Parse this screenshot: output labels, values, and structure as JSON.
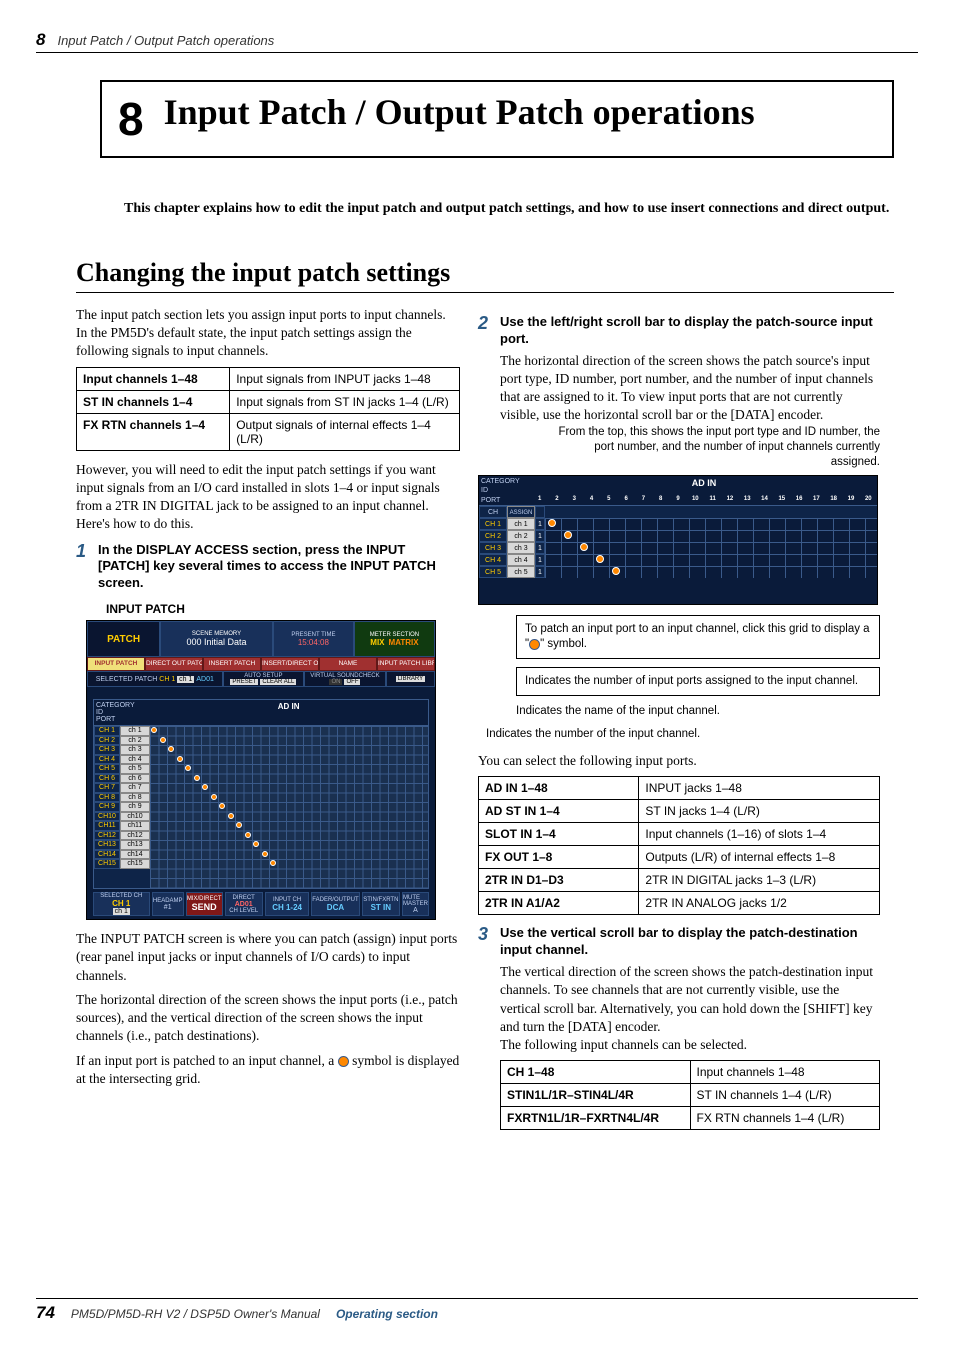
{
  "header": {
    "page_num": "8",
    "section": "Input Patch / Output Patch operations"
  },
  "chapter": {
    "num": "8",
    "title": "Input Patch / Output Patch operations"
  },
  "intro": "This chapter explains how to edit the input patch and output patch settings, and how to use insert connections and direct output.",
  "h1": "Changing the input patch settings",
  "left": {
    "p1": "The input patch section lets you assign input ports to input channels. In the PM5D's default state, the input patch settings assign the following signals to input channels.",
    "table1": [
      [
        "Input channels 1–48",
        "Input signals from INPUT jacks 1–48"
      ],
      [
        "ST IN channels 1–4",
        "Input signals from ST IN jacks 1–4 (L/R)"
      ],
      [
        "FX RTN channels 1–4",
        "Output signals of internal effects 1–4 (L/R)"
      ]
    ],
    "p2": "However, you will need to edit the input patch settings if you want input signals from an I/O card installed in slots 1–4 or input signals from a 2TR IN DIGITAL jack to be assigned to an input channel. Here's how to do this.",
    "step1": {
      "num": "1",
      "title": "In the DISPLAY ACCESS section, press the INPUT [PATCH] key several times to access the INPUT PATCH screen."
    },
    "caption": "INPUT PATCH",
    "p3": "The INPUT PATCH screen is where you can patch (assign) input ports (rear panel input jacks or input channels of I/O cards) to input channels.",
    "p4": "The horizontal direction of the screen shows the input ports (i.e., patch sources), and the vertical direction of the screen shows the input channels (i.e., patch destinations).",
    "p5a": "If an input port is patched to an input channel, a ",
    "p5b": " symbol is displayed at the intersecting grid."
  },
  "screenshot": {
    "patch_label": "PATCH",
    "scene_memory_label": "SCENE MEMORY",
    "scene_text": "000 Initial Data",
    "present_time_label": "PRESENT TIME",
    "present_time": "15:04:08",
    "meter_section_label": "METER SECTION",
    "mix": "MIX",
    "matrix": "MATRIX",
    "tabs": [
      "INPUT PATCH",
      "DIRECT OUT PATCH",
      "INSERT PATCH",
      "INSERT/DIRECT OUT POINT",
      "NAME",
      "INPUT PATCH LIBRARY"
    ],
    "sel_patch": "SELECTED PATCH",
    "sel_ch": "CH 1",
    "sel_name": "ch 1",
    "sel_port": "AD01",
    "auto_setup": "AUTO SETUP",
    "preset": "PRESET",
    "clear_all": "CLEAR ALL",
    "virtual_sc": "VIRTUAL SOUNDCHECK",
    "on": "ON",
    "off": "OFF",
    "library": "LIBRARY",
    "category": "CATEGORY",
    "id": "ID",
    "port": "PORT",
    "ch_col": "CH",
    "assign": "ASSIGN",
    "ad_in": "AD IN",
    "rows": [
      {
        "ch": "CH 1",
        "name": "ch 1"
      },
      {
        "ch": "CH 2",
        "name": "ch 2"
      },
      {
        "ch": "CH 3",
        "name": "ch 3"
      },
      {
        "ch": "CH 4",
        "name": "ch 4"
      },
      {
        "ch": "CH 5",
        "name": "ch 5"
      },
      {
        "ch": "CH 6",
        "name": "ch 6"
      },
      {
        "ch": "CH 7",
        "name": "ch 7"
      },
      {
        "ch": "CH 8",
        "name": "ch 8"
      },
      {
        "ch": "CH 9",
        "name": "ch 9"
      },
      {
        "ch": "CH10",
        "name": "ch10"
      },
      {
        "ch": "CH11",
        "name": "ch11"
      },
      {
        "ch": "CH12",
        "name": "ch12"
      },
      {
        "ch": "CH13",
        "name": "ch13"
      },
      {
        "ch": "CH14",
        "name": "ch14"
      },
      {
        "ch": "CH15",
        "name": "ch15"
      }
    ],
    "bottom": {
      "selected_ch": "SELECTED CH",
      "ch1": "CH 1",
      "chname": "ch 1",
      "headamp": "HEADAMP",
      "num1": "#1",
      "mix_direct": "MIX/DIRECT",
      "send": "SEND",
      "direct": "DIRECT",
      "dir_val": "AD01",
      "ch_level": "CH LEVEL",
      "input_ch": "INPUT CH",
      "ch124": "CH 1-24",
      "fader_output": "FADER/OUTPUT",
      "dca": "DCA",
      "stin_fxrtn": "STIN/FXRTN",
      "stin": "ST IN",
      "mute_master": "MUTE MASTER",
      "a": "A"
    }
  },
  "right": {
    "step2": {
      "num": "2",
      "title": "Use the left/right scroll bar to display the patch-source input port."
    },
    "p2a": "The horizontal direction of the screen shows the patch source's input port type, ID number, port number, and the number of input channels that are assigned to it. To view input ports that are not currently visible, use the horizontal scroll bar or the [DATA] encoder.",
    "callout1": "From the top, this shows the input port type and ID number, the port number, and the number of input channels currently assigned.",
    "callout2a": "To patch an input port to an input channel, click this grid to display a \"",
    "callout2b": "\" symbol.",
    "callout3": "Indicates the number of input ports assigned to the input channel.",
    "callout4": "Indicates the name of the input channel.",
    "callout5": "Indicates the number of the input channel.",
    "mini": {
      "category": "CATEGORY",
      "id": "ID",
      "port": "PORT",
      "ch": "CH",
      "assign": "ASSIGN",
      "adin": "AD IN",
      "ports": [
        "1",
        "2",
        "3",
        "4",
        "5",
        "6",
        "7",
        "8",
        "9",
        "10",
        "11",
        "12",
        "13",
        "14",
        "15",
        "16",
        "17",
        "18",
        "19",
        "20"
      ],
      "rows": [
        {
          "ch": "CH 1",
          "name": "ch 1",
          "n": "1"
        },
        {
          "ch": "CH 2",
          "name": "ch 2",
          "n": "1"
        },
        {
          "ch": "CH 3",
          "name": "ch 3",
          "n": "1"
        },
        {
          "ch": "CH 4",
          "name": "ch 4",
          "n": "1"
        },
        {
          "ch": "CH 5",
          "name": "ch 5",
          "n": "1"
        }
      ]
    },
    "p_ports": "You can select the following input ports.",
    "table_ports": [
      [
        "AD IN 1–48",
        "INPUT jacks 1–48"
      ],
      [
        "AD ST IN 1–4",
        "ST IN jacks 1–4 (L/R)"
      ],
      [
        "SLOT IN 1–4",
        "Input channels (1–16) of slots 1–4"
      ],
      [
        "FX OUT 1–8",
        "Outputs (L/R) of internal effects 1–8"
      ],
      [
        "2TR IN D1–D3",
        "2TR IN DIGITAL jacks 1–3 (L/R)"
      ],
      [
        "2TR IN A1/A2",
        "2TR IN ANALOG jacks 1/2"
      ]
    ],
    "step3": {
      "num": "3",
      "title": "Use the vertical scroll bar to display the patch-destination input channel."
    },
    "p3a": "The vertical direction of the screen shows the patch-destination input channels. To see channels that are not currently visible, use the vertical scroll bar. Alternatively, you can hold down the [SHIFT] key and turn the [DATA] encoder.",
    "p3b": "The following input channels can be selected.",
    "table_ch": [
      [
        "CH 1–48",
        "Input channels 1–48"
      ],
      [
        "STIN1L/1R–STIN4L/4R",
        "ST IN channels 1–4 (L/R)"
      ],
      [
        "FXRTN1L/1R–FXRTN4L/4R",
        "FX RTN channels 1–4 (L/R)"
      ]
    ]
  },
  "footer": {
    "page": "74",
    "book": "PM5D/PM5D-RH V2 / DSP5D Owner's Manual",
    "section": "Operating section"
  }
}
